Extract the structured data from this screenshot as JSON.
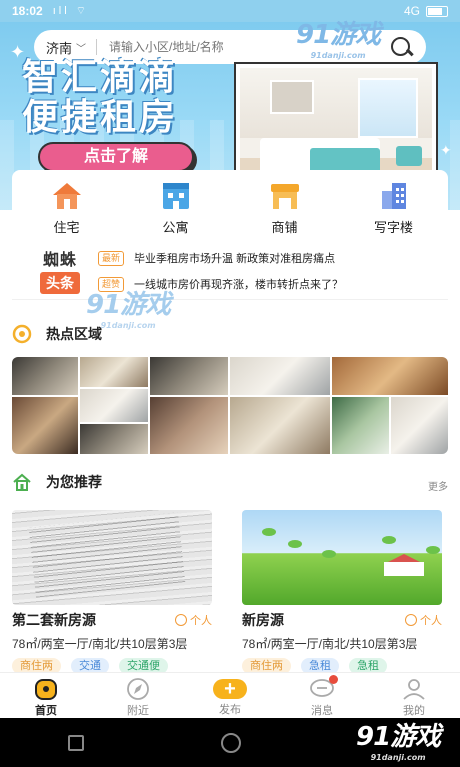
{
  "status_bar": {
    "time": "18:02",
    "signal": "4G",
    "network_icons": "ıll ⌔"
  },
  "search": {
    "city": "济南",
    "placeholder": "请输入小区/地址/名称"
  },
  "banner": {
    "line1": "智汇滴滴",
    "line2": "便捷租房",
    "cta": "点击了解"
  },
  "categories": [
    {
      "label": "住宅",
      "icon": "house-icon",
      "color": "#ef7a3a"
    },
    {
      "label": "公寓",
      "icon": "apartment-icon",
      "color": "#4ba6e6"
    },
    {
      "label": "商铺",
      "icon": "shop-icon",
      "color": "#f4a72b"
    },
    {
      "label": "写字楼",
      "icon": "office-building-icon",
      "color": "#5f86e0"
    }
  ],
  "headlines": {
    "brand_line1": "蜘蛛",
    "brand_line2": "头条",
    "items": [
      {
        "tag": "最新",
        "text": "毕业季租房市场升温 新政策对准租房痛点"
      },
      {
        "tag": "超赞",
        "text": "一线城市房价再现齐涨，楼市转折点来了？"
      }
    ]
  },
  "hot_area": {
    "title": "热点区域"
  },
  "recommend": {
    "title": "为您推荐",
    "more": "更多",
    "cards": [
      {
        "title": "第二套新房源",
        "owner": "个人",
        "desc": "78㎡/两室一厅/南北/共10层第3层",
        "tags": [
          "商住两",
          "交通",
          "交通便"
        ]
      },
      {
        "title": "新房源",
        "owner": "个人",
        "desc": "78㎡/两室一厅/南北/共10层第3层",
        "tags": [
          "商住两",
          "急租",
          "急租"
        ]
      }
    ]
  },
  "tabbar": [
    {
      "label": "首页",
      "icon": "home-icon",
      "active": true
    },
    {
      "label": "附近",
      "icon": "compass-icon",
      "active": false
    },
    {
      "label": "发布",
      "icon": "plus-icon",
      "active": false
    },
    {
      "label": "消息",
      "icon": "message-icon",
      "active": false
    },
    {
      "label": "我的",
      "icon": "profile-icon",
      "active": false
    }
  ],
  "watermark": {
    "logo": "91游戏",
    "domain": "91danji.com"
  },
  "colors": {
    "accent": "#f7b21c",
    "banner_blue": "#7fcbef",
    "cta_pink": "#ea5d8e",
    "tag_orange": "#f29a37"
  }
}
